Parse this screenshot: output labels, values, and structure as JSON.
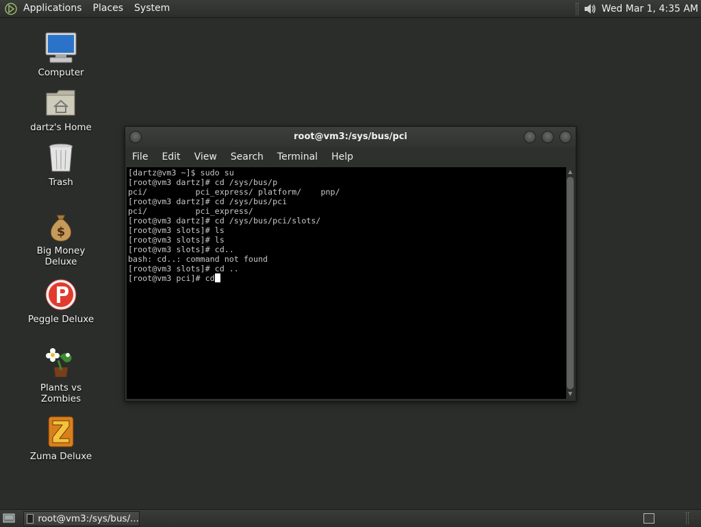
{
  "top_panel": {
    "menus": [
      "Applications",
      "Places",
      "System"
    ],
    "clock": "Wed Mar  1,  4:35 AM",
    "icons": {
      "logo": "app-menu-logo-icon",
      "volume": "volume-icon"
    }
  },
  "desktop": {
    "icons": [
      {
        "label": "Computer",
        "icon": "computer-icon"
      },
      {
        "label": "dartz's Home",
        "icon": "home-folder-icon"
      },
      {
        "label": "Trash",
        "icon": "trash-icon"
      },
      {
        "label": "Big Money Deluxe",
        "icon": "money-bag-icon"
      },
      {
        "label": "Peggle Deluxe",
        "icon": "peggle-icon"
      },
      {
        "label": "Plants vs Zombies",
        "icon": "plants-vs-zombies-icon"
      },
      {
        "label": "Zuma Deluxe",
        "icon": "zuma-icon"
      }
    ]
  },
  "terminal": {
    "title": "root@vm3:/sys/bus/pci",
    "menu": [
      "File",
      "Edit",
      "View",
      "Search",
      "Terminal",
      "Help"
    ],
    "lines": [
      "[dartz@vm3 ~]$ sudo su",
      "[root@vm3 dartz]# cd /sys/bus/p",
      "pci/          pci_express/ platform/    pnp/",
      "[root@vm3 dartz]# cd /sys/bus/pci",
      "pci/          pci_express/",
      "[root@vm3 dartz]# cd /sys/bus/pci/slots/",
      "[root@vm3 slots]# ls",
      "[root@vm3 slots]# ls",
      "[root@vm3 slots]# cd..",
      "bash: cd..: command not found",
      "[root@vm3 slots]# cd ..",
      "[root@vm3 pci]# cd"
    ]
  },
  "bottom_panel": {
    "task_label": "root@vm3:/sys/bus/..."
  },
  "colors": {
    "desktop_bg": "#2b2d2a",
    "terminal_bg": "#000000",
    "terminal_fg": "#c8c8c8"
  }
}
